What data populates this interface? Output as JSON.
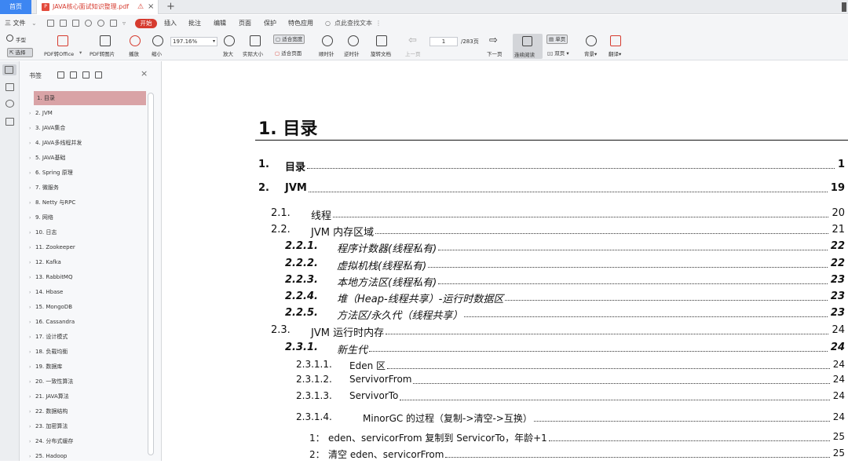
{
  "tabs": {
    "home": "首页",
    "document": "JAVA核心面试知识整理.pdf",
    "warn_icon": "⚠",
    "close": "×",
    "add": "+"
  },
  "menu": {
    "file": "三 文件",
    "file_caret": "⌄",
    "start": "开始",
    "insert": "插入",
    "annotate": "批注",
    "edit": "编辑",
    "page": "页面",
    "protect": "保护",
    "features": "特色应用",
    "search_placeholder": "点此查找文本",
    "more": "⋮"
  },
  "toolbar": {
    "hand": "手型",
    "select": "选择",
    "pdf_to_office": "PDF转Office",
    "pdf_to_image": "PDF转图片",
    "play": "播放",
    "zoom_out": "缩小",
    "zoom_value": "197.16%",
    "zoom_in": "放大",
    "actual_size": "实际大小",
    "fit_width": "适合宽度",
    "fit_page": "适合页面",
    "rotate_cw": "顺时针",
    "rotate_ccw": "逆时针",
    "rotate_doc": "旋转文档",
    "prev_page": "上一页",
    "page_current": "1",
    "page_total": "/283页",
    "next_page": "下一页",
    "continuous_read": "连续阅读",
    "single_page": "单页",
    "double_page": "双页",
    "background": "背景",
    "translate": "翻译"
  },
  "bookmarks": {
    "title": "书签",
    "close": "×",
    "items": [
      "1. 目录",
      "2. JVM",
      "3. JAVA集合",
      "4. JAVA多线程并发",
      "5. JAVA基础",
      "6. Spring 原理",
      "7.  微服务",
      "8. Netty 与RPC",
      "9. 网络",
      "10. 日志",
      "11. Zookeeper",
      "12. Kafka",
      "13. RabbitMQ",
      "14. Hbase",
      "15. MongoDB",
      "16. Cassandra",
      "17. 设计模式",
      "18. 负载均衡",
      "19. 数据库",
      "20. 一致性算法",
      "21. JAVA算法",
      "22. 数据结构",
      "23. 加密算法",
      "24. 分布式缓存",
      "25. Hadoop"
    ]
  },
  "document": {
    "heading": "1. 目录",
    "toc": [
      {
        "num": "1.",
        "text": "目录",
        "page": "1"
      },
      {
        "num": "2.",
        "text": "JVM",
        "page": "19"
      },
      {
        "num": "2.1.",
        "text": "线程",
        "page": "20"
      },
      {
        "num": "2.2.",
        "text": "JVM 内存区域",
        "page": "21"
      },
      {
        "num": "2.2.1.",
        "text": "程序计数器(线程私有)",
        "page": "22"
      },
      {
        "num": "2.2.2.",
        "text": "虚拟机栈(线程私有)",
        "page": "22"
      },
      {
        "num": "2.2.3.",
        "text": "本地方法区(线程私有)",
        "page": "23"
      },
      {
        "num": "2.2.4.",
        "text": "堆（Heap-线程共享）-运行时数据区",
        "page": "23"
      },
      {
        "num": "2.2.5.",
        "text": "方法区/永久代（线程共享）",
        "page": "23"
      },
      {
        "num": "2.3.",
        "text": "JVM 运行时内存",
        "page": "24"
      },
      {
        "num": "2.3.1.",
        "text": "新生代",
        "page": "24"
      },
      {
        "num": "2.3.1.1.",
        "text": "Eden 区",
        "page": "24"
      },
      {
        "num": "2.3.1.2.",
        "text": "ServivorFrom",
        "page": "24"
      },
      {
        "num": "2.3.1.3.",
        "text": "ServivorTo",
        "page": "24"
      },
      {
        "num": "2.3.1.4.",
        "text": "MinorGC 的过程（复制->清空->互换）",
        "page": "24"
      },
      {
        "num": "1：",
        "text": "eden、servicorFrom 复制到 ServicorTo，年龄+1",
        "page": "25"
      },
      {
        "num": "2：",
        "text": "清空 eden、servicorFrom",
        "page": "25"
      }
    ]
  }
}
